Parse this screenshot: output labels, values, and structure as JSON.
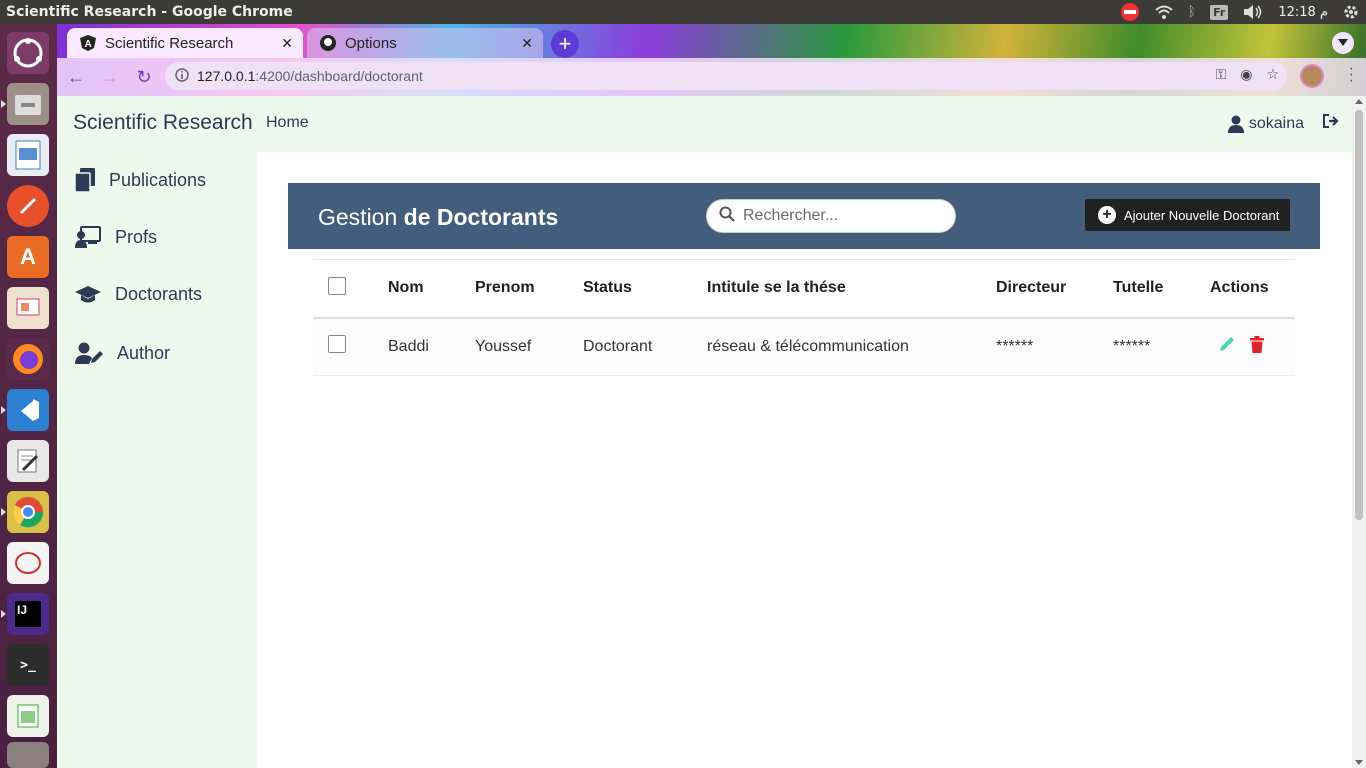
{
  "os": {
    "window_title": "Scientific Research - Google Chrome",
    "tray": {
      "keyboard_layout": "Fr",
      "time": "12:18 م"
    }
  },
  "browser": {
    "tabs": [
      {
        "label": "Scientific Research",
        "active": true
      },
      {
        "label": "Options",
        "active": false
      }
    ],
    "url_host": "127.0.0.1",
    "url_rest": ":4200/dashboard/doctorant"
  },
  "app": {
    "brand": "Scientific Research",
    "nav_home": "Home",
    "user_name": "sokaina",
    "sidebar": [
      {
        "label": "Publications",
        "icon": "publications-icon"
      },
      {
        "label": "Profs",
        "icon": "profs-icon"
      },
      {
        "label": "Doctorants",
        "icon": "graduation-cap-icon"
      },
      {
        "label": "Author",
        "icon": "user-edit-icon"
      }
    ],
    "panel": {
      "title_light": "Gestion",
      "title_bold": "de Doctorants",
      "search_placeholder": "Rechercher...",
      "add_button": "Ajouter Nouvelle Doctorant"
    },
    "table": {
      "columns": [
        "Nom",
        "Prenom",
        "Status",
        "Intitule se la thése",
        "Directeur",
        "Tutelle",
        "Actions"
      ],
      "rows": [
        {
          "nom": "Baddi",
          "prenom": "Youssef",
          "status": "Doctorant",
          "intitule": "réseau & télécommunication",
          "directeur": "******",
          "tutelle": "******"
        }
      ]
    },
    "colors": {
      "header_bar": "#435d7d",
      "sidebar_bg": "#eefaee",
      "edit": "#4cd6a0",
      "delete": "#e0242d"
    }
  }
}
